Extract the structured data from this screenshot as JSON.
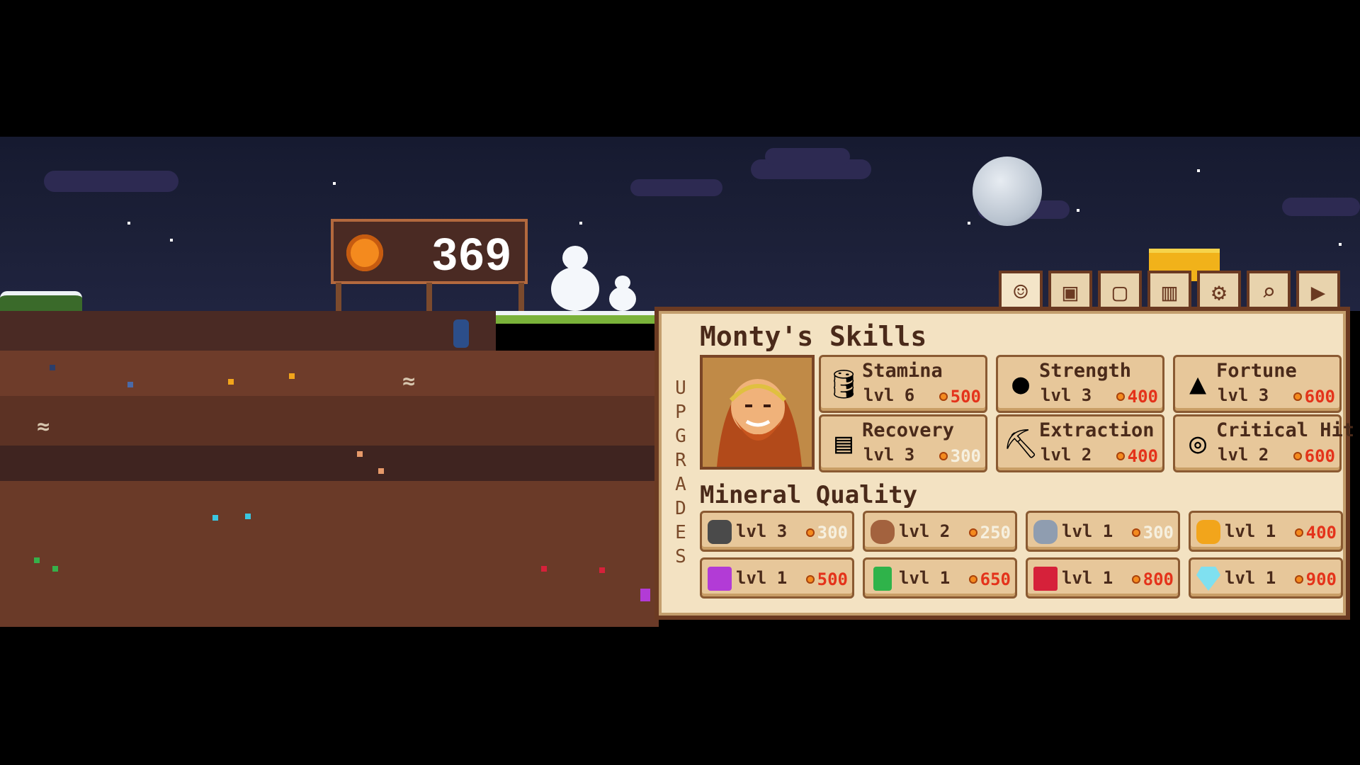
{
  "hud": {
    "coins": "369"
  },
  "tabs": [
    {
      "icon": "monty-portrait-icon",
      "active": true
    },
    {
      "icon": "treasure-chest-icon",
      "active": false
    },
    {
      "icon": "framed-picture-icon",
      "active": false
    },
    {
      "icon": "stats-book-icon",
      "active": false
    },
    {
      "icon": "gear-icon",
      "active": false
    },
    {
      "icon": "magnifier-icon",
      "active": false
    },
    {
      "icon": "play-next-icon",
      "active": false
    }
  ],
  "panel": {
    "title": "Monty's Skills",
    "side_label": "UPGRADES",
    "skills": [
      {
        "name": "Stamina",
        "level": "lvl 6",
        "cost": "500",
        "icon": "barrel-icon",
        "affordable": false
      },
      {
        "name": "Strength",
        "level": "lvl 3",
        "cost": "400",
        "icon": "weight-icon",
        "affordable": false
      },
      {
        "name": "Fortune",
        "level": "lvl 3",
        "cost": "600",
        "icon": "gold-bars-icon",
        "affordable": false
      },
      {
        "name": "Recovery",
        "level": "lvl 3",
        "cost": "300",
        "icon": "bed-icon",
        "affordable": true
      },
      {
        "name": "Extraction",
        "level": "lvl 2",
        "cost": "400",
        "icon": "pickaxe-icon",
        "affordable": false
      },
      {
        "name": "Critical Hit",
        "level": "lvl 2",
        "cost": "600",
        "icon": "target-icon",
        "affordable": false
      }
    ],
    "mineral_title": "Mineral Quality",
    "minerals": [
      {
        "level": "lvl 3",
        "cost": "300",
        "icon": "coal-icon",
        "color": "#4a4a4a",
        "affordable": true
      },
      {
        "level": "lvl 2",
        "cost": "250",
        "icon": "copper-ore-icon",
        "color": "#a3623e",
        "affordable": true
      },
      {
        "level": "lvl 1",
        "cost": "300",
        "icon": "iron-ore-icon",
        "color": "#8f9db0",
        "affordable": true
      },
      {
        "level": "lvl 1",
        "cost": "400",
        "icon": "gold-ore-icon",
        "color": "#f2a51b",
        "affordable": false
      },
      {
        "level": "lvl 1",
        "cost": "500",
        "icon": "amethyst-icon",
        "color": "#b23bd6",
        "affordable": false
      },
      {
        "level": "lvl 1",
        "cost": "650",
        "icon": "emerald-icon",
        "color": "#2fb34a",
        "affordable": false
      },
      {
        "level": "lvl 1",
        "cost": "800",
        "icon": "ruby-icon",
        "color": "#d6213a",
        "affordable": false
      },
      {
        "level": "lvl 1",
        "cost": "900",
        "icon": "diamond-icon",
        "color": "#7fe0f0",
        "affordable": false
      }
    ]
  },
  "colors": {
    "cost_unaffordable": "#e4331b",
    "cost_affordable": "#f6f0df",
    "panel_bg": "#f3e2c2",
    "panel_border": "#6b3a22"
  }
}
